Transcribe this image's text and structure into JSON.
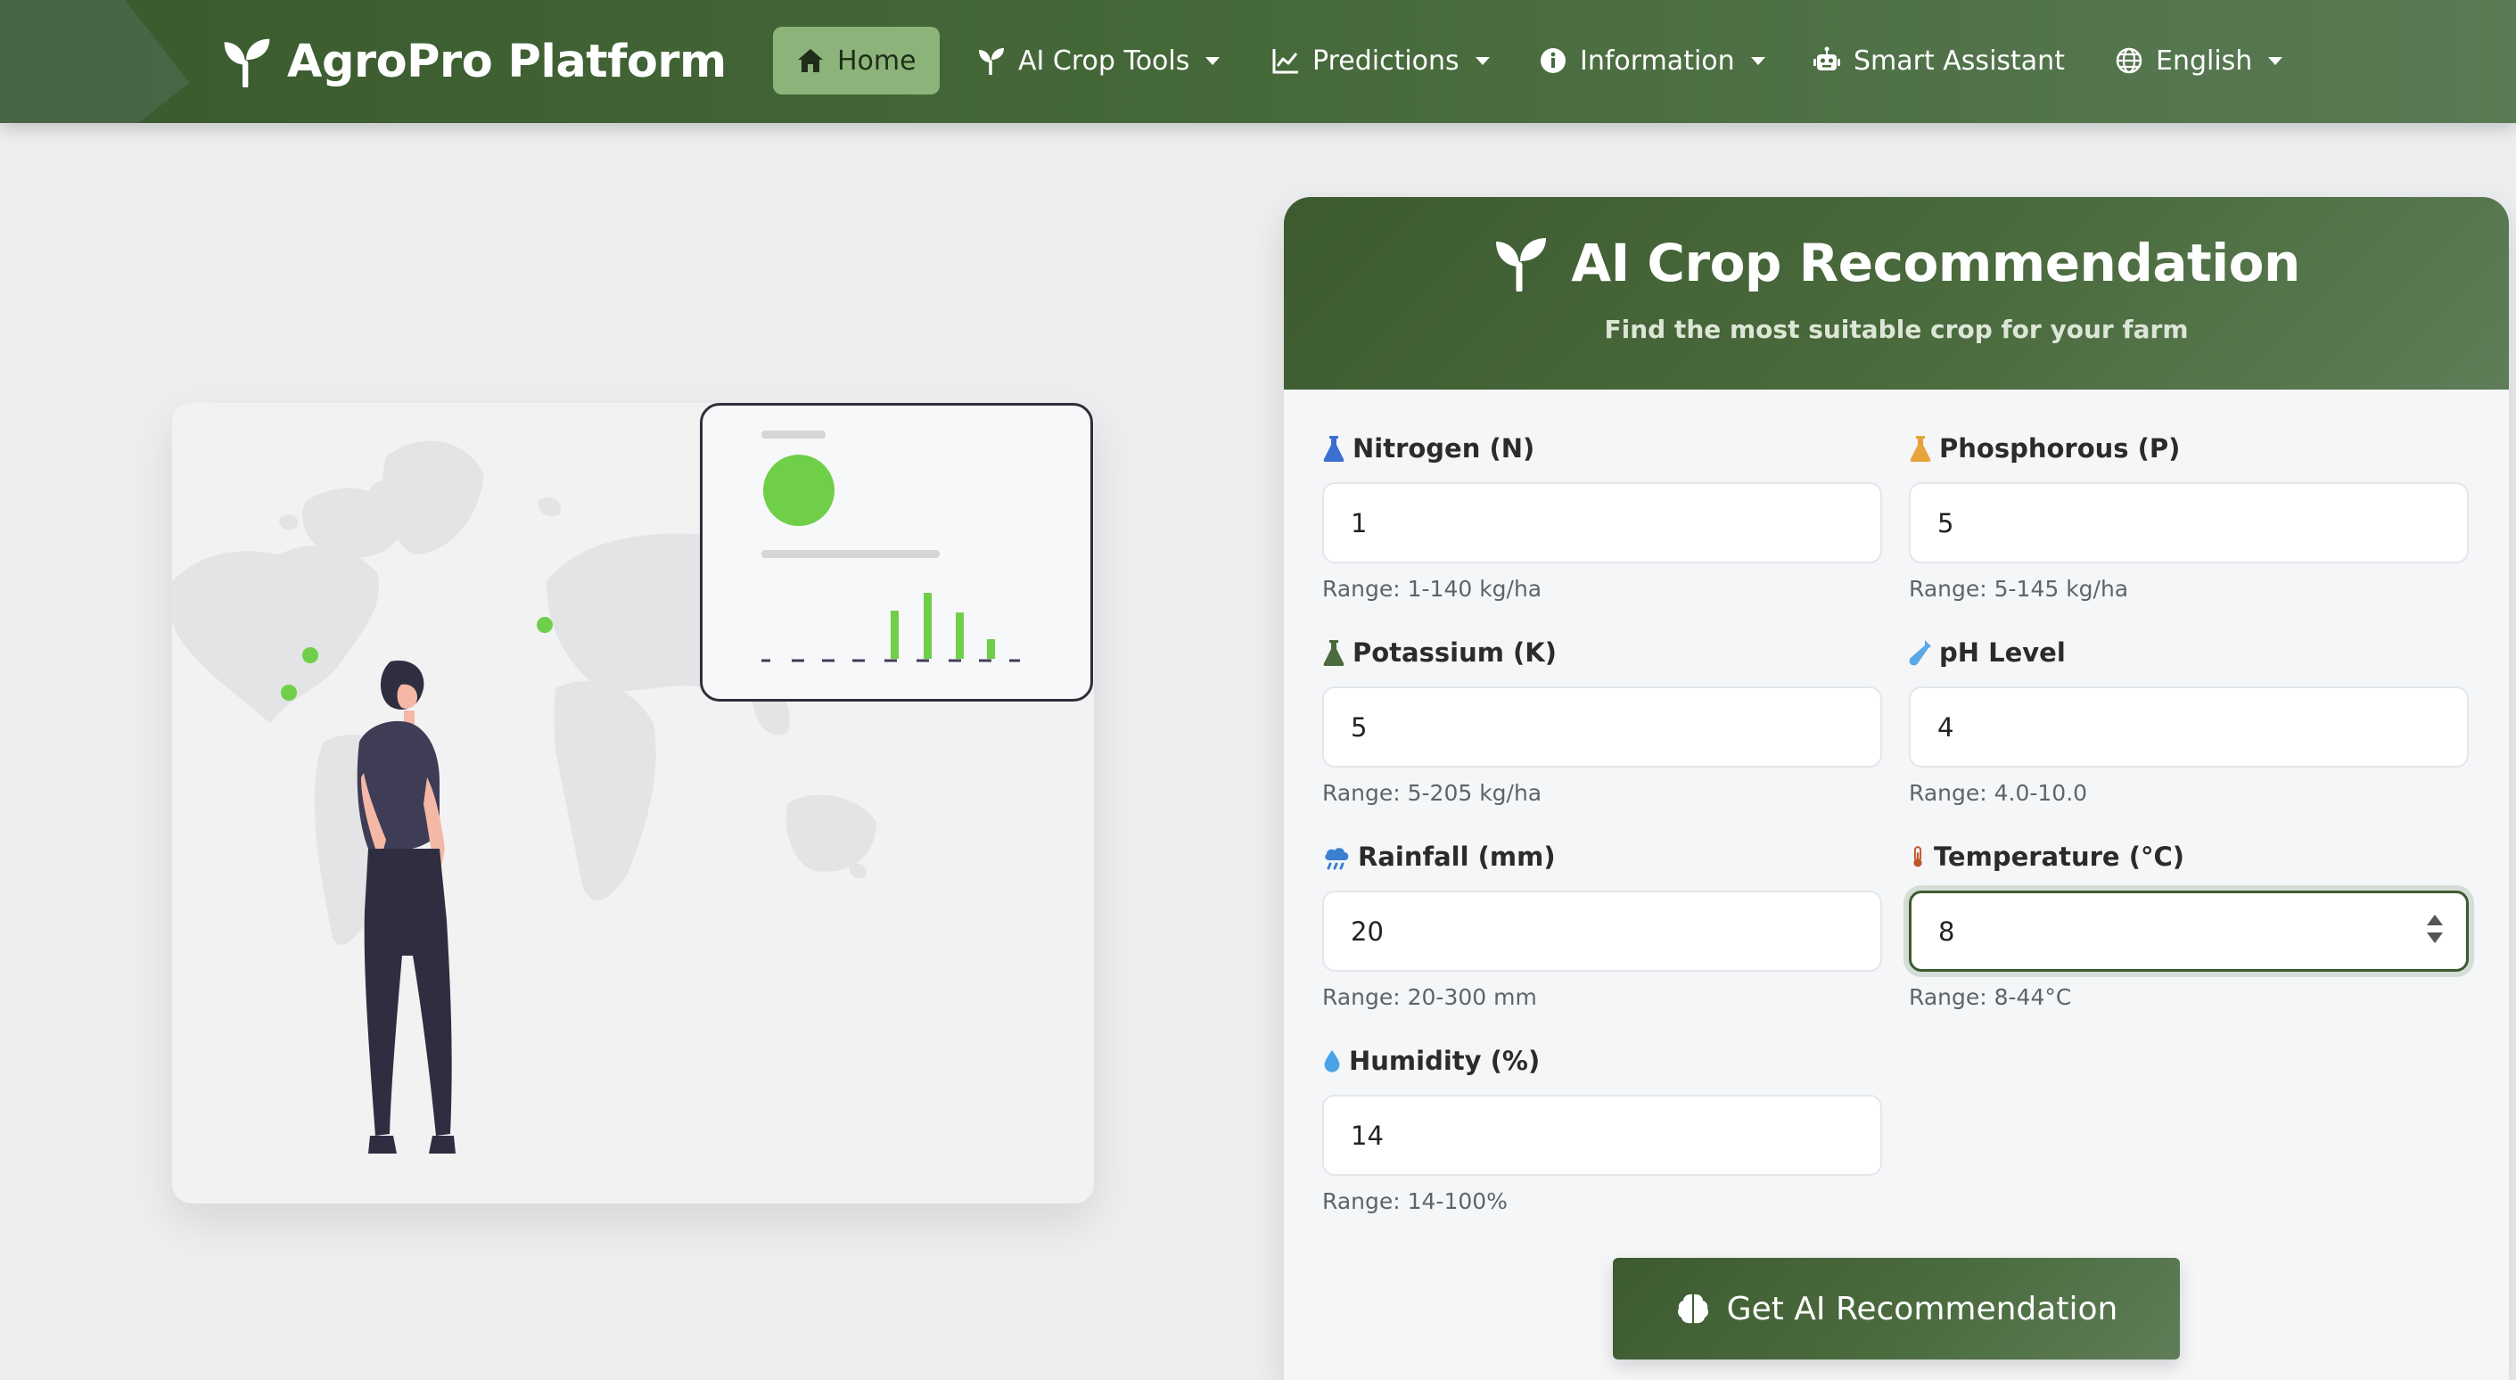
{
  "nav": {
    "brand": "AgroPro Platform",
    "items": [
      {
        "label": "Home",
        "icon": "home-icon",
        "active": true
      },
      {
        "label": "AI Crop Tools",
        "icon": "seedling-icon",
        "dropdown": true
      },
      {
        "label": "Predictions",
        "icon": "chart-line-icon",
        "dropdown": true
      },
      {
        "label": "Information",
        "icon": "info-circle-icon",
        "dropdown": true
      },
      {
        "label": "Smart Assistant",
        "icon": "robot-icon"
      },
      {
        "label": "English",
        "icon": "globe-icon",
        "dropdown": true
      }
    ]
  },
  "card": {
    "title": "AI Crop Recommendation",
    "subtitle": "Find the most suitable crop for your farm",
    "fields": [
      {
        "label": "Nitrogen (N)",
        "value": "1",
        "hint": "Range: 1-140 kg/ha",
        "icon": "flask-icon",
        "color": "#3b6fd0"
      },
      {
        "label": "Phosphorous (P)",
        "value": "5",
        "hint": "Range: 5-145 kg/ha",
        "icon": "flask-icon",
        "color": "#e8a23a"
      },
      {
        "label": "Potassium (K)",
        "value": "5",
        "hint": "Range: 5-205 kg/ha",
        "icon": "flask-icon",
        "color": "#4a6b3d"
      },
      {
        "label": "pH Level",
        "value": "4",
        "hint": "Range: 4.0-10.0",
        "icon": "vial-icon",
        "color": "#5aa8e6"
      },
      {
        "label": "Rainfall (mm)",
        "value": "20",
        "hint": "Range: 20-300 mm",
        "icon": "cloud-rain-icon",
        "color": "#3b7fd0"
      },
      {
        "label": "Temperature (°C)",
        "value": "8",
        "hint": "Range: 8-44°C",
        "icon": "thermometer-icon",
        "color": "#c0552a",
        "focused": true
      },
      {
        "label": "Humidity (%)",
        "value": "14",
        "hint": "Range: 14-100%",
        "icon": "droplet-icon",
        "color": "#4aa3e6"
      }
    ],
    "submit_label": "Get AI Recommendation"
  },
  "colors": {
    "nav_bg": "#46693a",
    "active_nav": "#8cb47a",
    "accent_green": "#6fcf48",
    "card_header": "#4a6b3d"
  }
}
